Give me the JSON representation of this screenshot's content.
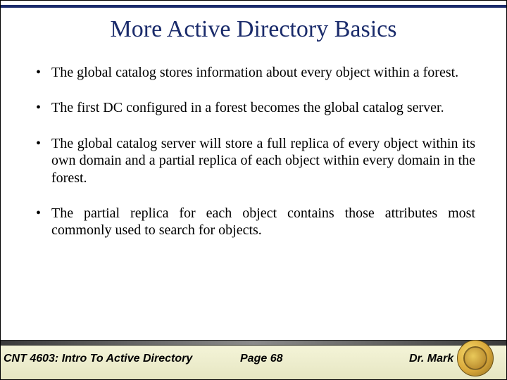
{
  "title": "More Active Directory Basics",
  "bullets": [
    "The global catalog stores information about every object within a forest.",
    "The first DC configured in a forest becomes the global catalog server.",
    "The global catalog server will store a full replica of every object within its own domain and a partial replica of each object within every domain in the forest.",
    "The partial replica for each object contains those attributes most commonly used to search for objects."
  ],
  "footer": {
    "course": "CNT 4603: Intro To Active Directory",
    "page": "Page 68",
    "author": "Dr. Mark"
  }
}
